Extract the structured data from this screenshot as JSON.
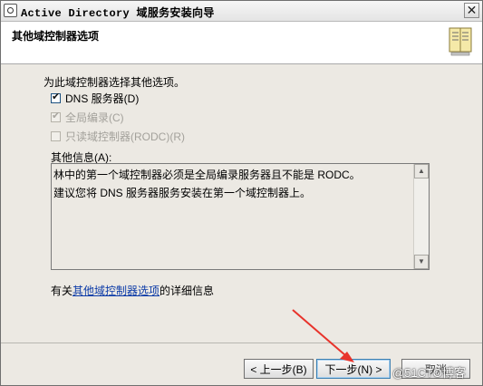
{
  "window": {
    "title": "Active Directory 域服务安装向导",
    "close_glyph": "✕"
  },
  "header": {
    "title": "其他域控制器选项"
  },
  "main": {
    "intro": "为此域控制器选择其他选项。",
    "options": [
      {
        "label": "DNS 服务器(D)",
        "checked": true,
        "enabled": true
      },
      {
        "label": "全局编录(C)",
        "checked": true,
        "enabled": false
      },
      {
        "label": "只读域控制器(RODC)(R)",
        "checked": false,
        "enabled": false
      }
    ],
    "info_label": "其他信息(A):",
    "info_lines": [
      "林中的第一个域控制器必须是全局编录服务器且不能是 RODC。",
      "建议您将 DNS 服务器服务安装在第一个域控制器上。"
    ],
    "more_prefix": "有关",
    "more_link": "其他域控制器选项",
    "more_suffix": "的详细信息"
  },
  "footer": {
    "back_label": "< 上一步(B)",
    "next_label": "下一步(N) >",
    "cancel_label": "取消"
  },
  "overlay": {
    "watermark": "@51CTO博客",
    "arrow_color": "#e8332b"
  },
  "icons": {
    "app": "window-app-icon",
    "wizard": "book-icon",
    "check": "✔",
    "scroll_up": "▲",
    "scroll_down": "▼"
  }
}
